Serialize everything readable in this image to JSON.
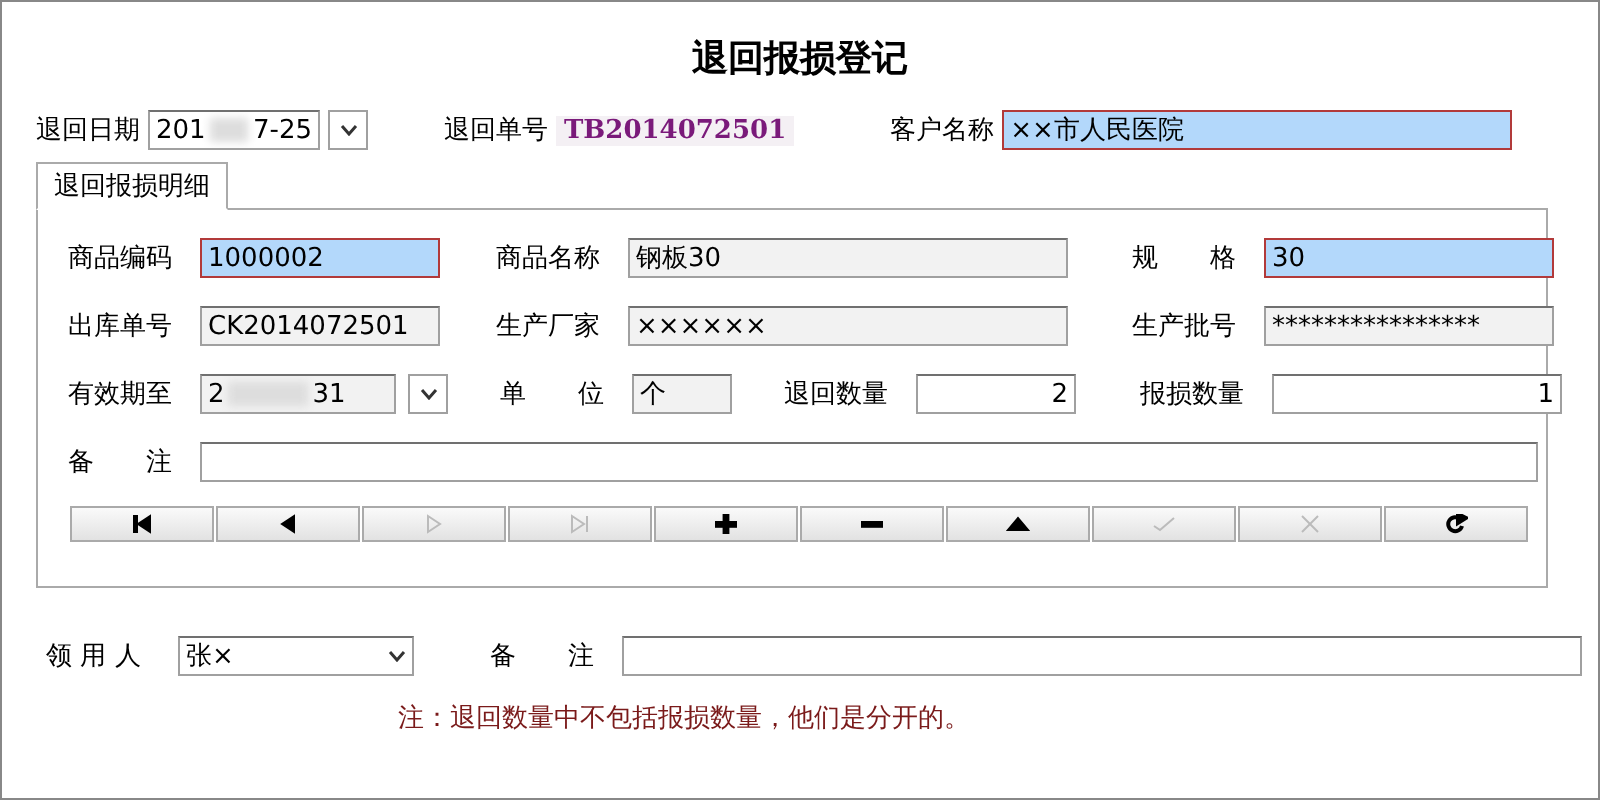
{
  "window": {
    "title": "退回报损登记"
  },
  "header": {
    "date": {
      "label": "退回日期",
      "visible_start": "201",
      "visible_end": "7-25"
    },
    "order_no": {
      "label": "退回单号",
      "value": "TB2014072501"
    },
    "customer": {
      "label": "客户名称",
      "value": "××市人民医院",
      "focused": true
    }
  },
  "tabs": [
    {
      "label": "退回报损明细",
      "selected": true
    }
  ],
  "detail_rows": [
    [
      {
        "label": "商品编码",
        "value": "1000002",
        "focused": true,
        "readonly": false
      },
      {
        "label": "商品名称",
        "value": "钢板30",
        "focused": false,
        "readonly": true
      },
      {
        "label": "规　　格",
        "value": "30",
        "focused": true,
        "readonly": false
      }
    ],
    [
      {
        "label": "出库单号",
        "value": "CK2014072501",
        "focused": false,
        "readonly": true
      },
      {
        "label": "生产厂家",
        "value": "××××××",
        "focused": false,
        "readonly": true
      },
      {
        "label": "生产批号",
        "value": "****************",
        "focused": false,
        "readonly": true
      }
    ]
  ],
  "expiry": {
    "label": "有效期至",
    "visible_start": "2",
    "visible_end": "31"
  },
  "unit": {
    "label": "单　　位",
    "value": "个"
  },
  "return_qty": {
    "label": "退回数量",
    "value": "2"
  },
  "loss_qty": {
    "label": "报损数量",
    "value": "1"
  },
  "detail_note": {
    "label": "备　　注"
  },
  "nav_buttons": [
    {
      "kind": "first",
      "disabled": false
    },
    {
      "kind": "prev",
      "disabled": false
    },
    {
      "kind": "next",
      "disabled": true
    },
    {
      "kind": "last",
      "disabled": true
    },
    {
      "kind": "add",
      "disabled": false
    },
    {
      "kind": "delete",
      "disabled": false
    },
    {
      "kind": "up",
      "disabled": false
    },
    {
      "kind": "confirm",
      "disabled": true
    },
    {
      "kind": "cancel",
      "disabled": true
    },
    {
      "kind": "refresh",
      "disabled": false
    }
  ],
  "receiver": {
    "label": "领 用 人",
    "value": "张×"
  },
  "note": {
    "label": "备　　注"
  },
  "footnote": "注：退回数量中不包括报损数量，他们是分开的。"
}
